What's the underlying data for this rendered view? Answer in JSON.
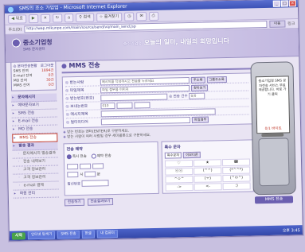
{
  "window": {
    "title": "SMS의 조소 가입업 - Microsoft Internet Explorer"
  },
  "toolbar": {
    "back": "뒤로",
    "forward": "",
    "search": "검색",
    "favorites": "즐겨찾기"
  },
  "address": {
    "label": "주소(D)",
    "url": "http://wap.mikunpe.com/main/source/send/vq/main_send.jsp",
    "go": "이동",
    "links": "링크"
  },
  "banner": {
    "logo_name": "중소기업청",
    "logo_sub": "SMS 문자센터",
    "slogan_small": "중소기업청",
    "slogan": "오늘의 일터, 내일의 희망입니다"
  },
  "account": {
    "head_left": "◎ 문자전송현황",
    "head_right": "로그아웃",
    "rows": [
      {
        "label": "SMS 잔여",
        "value": "1894건"
      },
      {
        "label": "E-mail 잔여",
        "value": "0건"
      },
      {
        "label": "MO 잔여",
        "value": "30건"
      },
      {
        "label": "MMS 잔여",
        "value": "0건"
      }
    ]
  },
  "menu": [
    {
      "label": "문자메시지",
      "type": "group"
    },
    {
      "label": "예약문자보기",
      "type": "item"
    },
    {
      "label": "SMS 전송",
      "type": "item"
    },
    {
      "label": "E-mail 전송",
      "type": "item"
    },
    {
      "label": "MO 전송",
      "type": "item"
    },
    {
      "label": "MMS 전송",
      "type": "active"
    },
    {
      "label": "발송 결과",
      "type": "group"
    },
    {
      "label": "문자메시지 발송결과",
      "type": "sub"
    },
    {
      "label": "전송 내역보기",
      "type": "sub"
    },
    {
      "label": "고객 정보관리",
      "type": "sub"
    },
    {
      "label": "고객 정보관리",
      "type": "sub"
    },
    {
      "label": "e-mail 결제",
      "type": "sub"
    },
    {
      "label": "회원 관리",
      "type": "item"
    }
  ],
  "page": {
    "title": "MMS 전송"
  },
  "form": {
    "rows": [
      {
        "label": "받는사람",
        "placeholder": "메시지를 작성하시고 전송을 누르세요",
        "btn1": "주소록",
        "btn2": "그룹주소록"
      },
      {
        "label": "파일제목",
        "value": "파일 첨부용 이미지",
        "btn1": "찾아보기"
      },
      {
        "label": "받는번호(번호)",
        "value": ""
      },
      {
        "label": "보내는번호",
        "value": "010"
      },
      {
        "label": "메시지제목",
        "value": ""
      },
      {
        "label": "멀티미디어",
        "btn1": "파일첨부"
      }
    ],
    "byte_label": "◎ 전송 건수",
    "byte_value": "0/0"
  },
  "notes": [
    "받는 번호는 엔터(ENTER)로 구분하세요.",
    "받는 사람이 여러 사람일 경우 세미콜론으로 구분하세요."
  ],
  "send_options": {
    "title": "전송 예약",
    "radio1": "즉시 전송",
    "radio2": "예약 전송",
    "booking_label": "예약시간",
    "time_h": "시",
    "time_m": "분",
    "date_label": "발신번호"
  },
  "emoticon": {
    "title": "특수 문자",
    "tabs": [
      "특수문자",
      "이모티콘"
    ],
    "cells": [
      "♡",
      "★",
      "☎",
      "ⓞⓞ",
      "(^^)",
      "(*^^*)",
      "^ㅇ^",
      "(ㅜ)",
      "(^ㅁ^)",
      "->",
      "<-",
      ":)"
    ]
  },
  "buttons": {
    "save": "전송하기",
    "list": "전송결과보기"
  },
  "phone": {
    "text": "중소기업청 SMS 문자전송 서비스 무료 제공합니다. 바로 가기 클릭",
    "counter": "0/1 바이트",
    "send": "MMS 전송"
  },
  "taskbar": {
    "start": "시작",
    "tasks": [
      "인터넷 탐색기",
      "SMS 전송",
      "한글",
      "내 컴퓨터"
    ],
    "clock": "오후 3:45"
  }
}
